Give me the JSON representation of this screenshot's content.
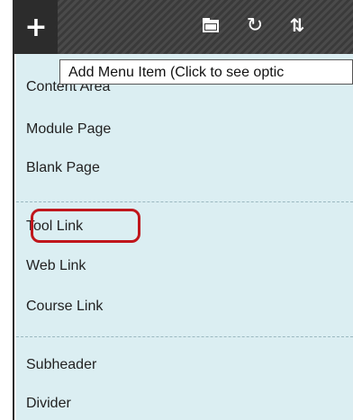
{
  "toolbar": {
    "add_icon": "+",
    "add_icon_name": "plus-icon",
    "folder_icon_name": "folder-icon",
    "refresh_icon": "↻",
    "sort_icon": "⇅"
  },
  "tooltip": {
    "text": "Add Menu Item (Click to see optic"
  },
  "menu": {
    "items": [
      {
        "label": "Content Area"
      },
      {
        "label": "Module Page"
      },
      {
        "label": "Blank Page"
      },
      {
        "label": "Tool Link"
      },
      {
        "label": "Web Link"
      },
      {
        "label": "Course Link"
      },
      {
        "label": "Subheader"
      },
      {
        "label": "Divider"
      }
    ]
  },
  "colors": {
    "toolbar_bg": "#3f3f3f",
    "menu_bg": "#dbeef2",
    "highlight": "#c0161c"
  }
}
